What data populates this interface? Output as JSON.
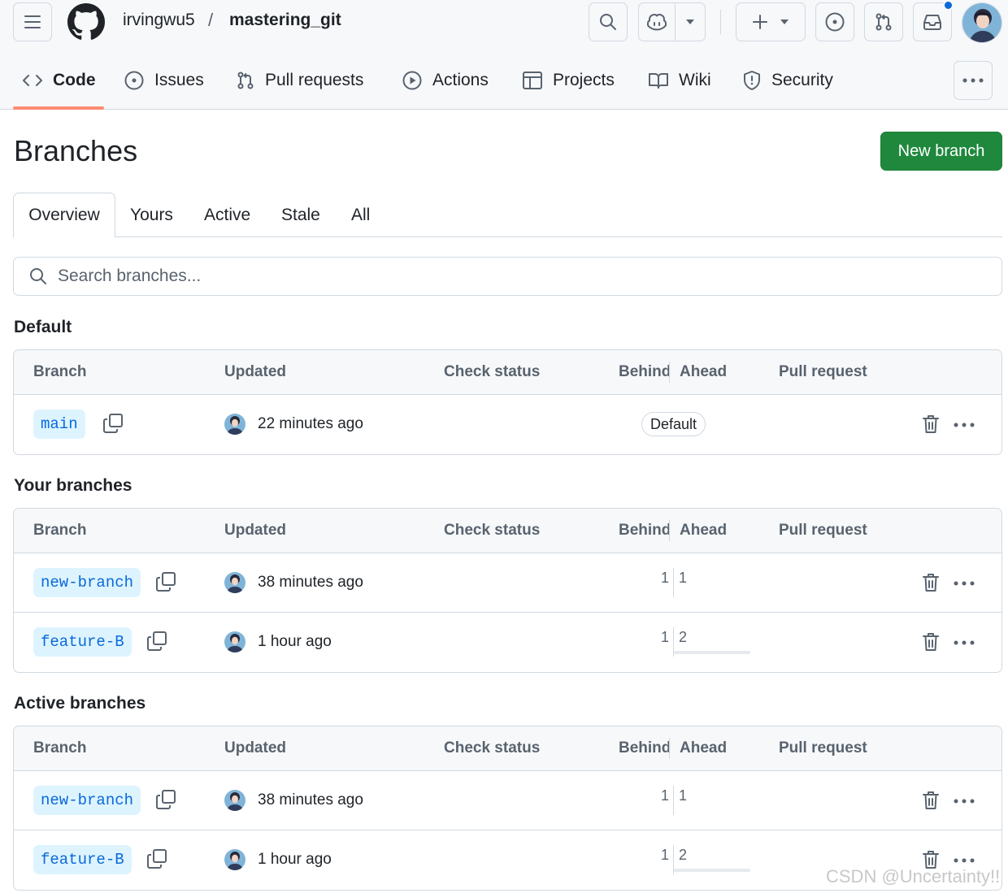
{
  "header": {
    "owner": "irvingwu5",
    "separator": "/",
    "repo": "mastering_git"
  },
  "nav": {
    "items": [
      {
        "label": "Code",
        "icon": "code-icon",
        "active": true
      },
      {
        "label": "Issues",
        "icon": "issue-icon"
      },
      {
        "label": "Pull requests",
        "icon": "pull-request-icon"
      },
      {
        "label": "Actions",
        "icon": "play-icon"
      },
      {
        "label": "Projects",
        "icon": "table-icon"
      },
      {
        "label": "Wiki",
        "icon": "book-icon"
      },
      {
        "label": "Security",
        "icon": "shield-icon"
      }
    ]
  },
  "page": {
    "title": "Branches",
    "new_branch_label": "New branch"
  },
  "tabs": [
    {
      "label": "Overview",
      "selected": true
    },
    {
      "label": "Yours"
    },
    {
      "label": "Active"
    },
    {
      "label": "Stale"
    },
    {
      "label": "All"
    }
  ],
  "search": {
    "placeholder": "Search branches..."
  },
  "columns": {
    "branch": "Branch",
    "updated": "Updated",
    "check_status": "Check status",
    "behind": "Behind",
    "ahead": "Ahead",
    "pull_request": "Pull request"
  },
  "sections": [
    {
      "title": "Default",
      "rows": [
        {
          "branch": "main",
          "updated": "22 minutes ago",
          "badge": "Default"
        }
      ]
    },
    {
      "title": "Your branches",
      "rows": [
        {
          "branch": "new-branch",
          "updated": "38 minutes ago",
          "behind": "1",
          "ahead": "1"
        },
        {
          "branch": "feature-B",
          "updated": "1 hour ago",
          "behind": "1",
          "ahead": "2"
        }
      ]
    },
    {
      "title": "Active branches",
      "rows": [
        {
          "branch": "new-branch",
          "updated": "38 minutes ago",
          "behind": "1",
          "ahead": "1"
        },
        {
          "branch": "feature-B",
          "updated": "1 hour ago",
          "behind": "1",
          "ahead": "2"
        }
      ]
    }
  ],
  "watermark": "CSDN @Uncertainty!!",
  "colors": {
    "primary_button": "#1f883d",
    "branch_tag_bg": "#ddf4ff",
    "branch_tag_text": "#0969da",
    "nav_underline": "#fd8c73",
    "notification_dot": "#0969da"
  }
}
